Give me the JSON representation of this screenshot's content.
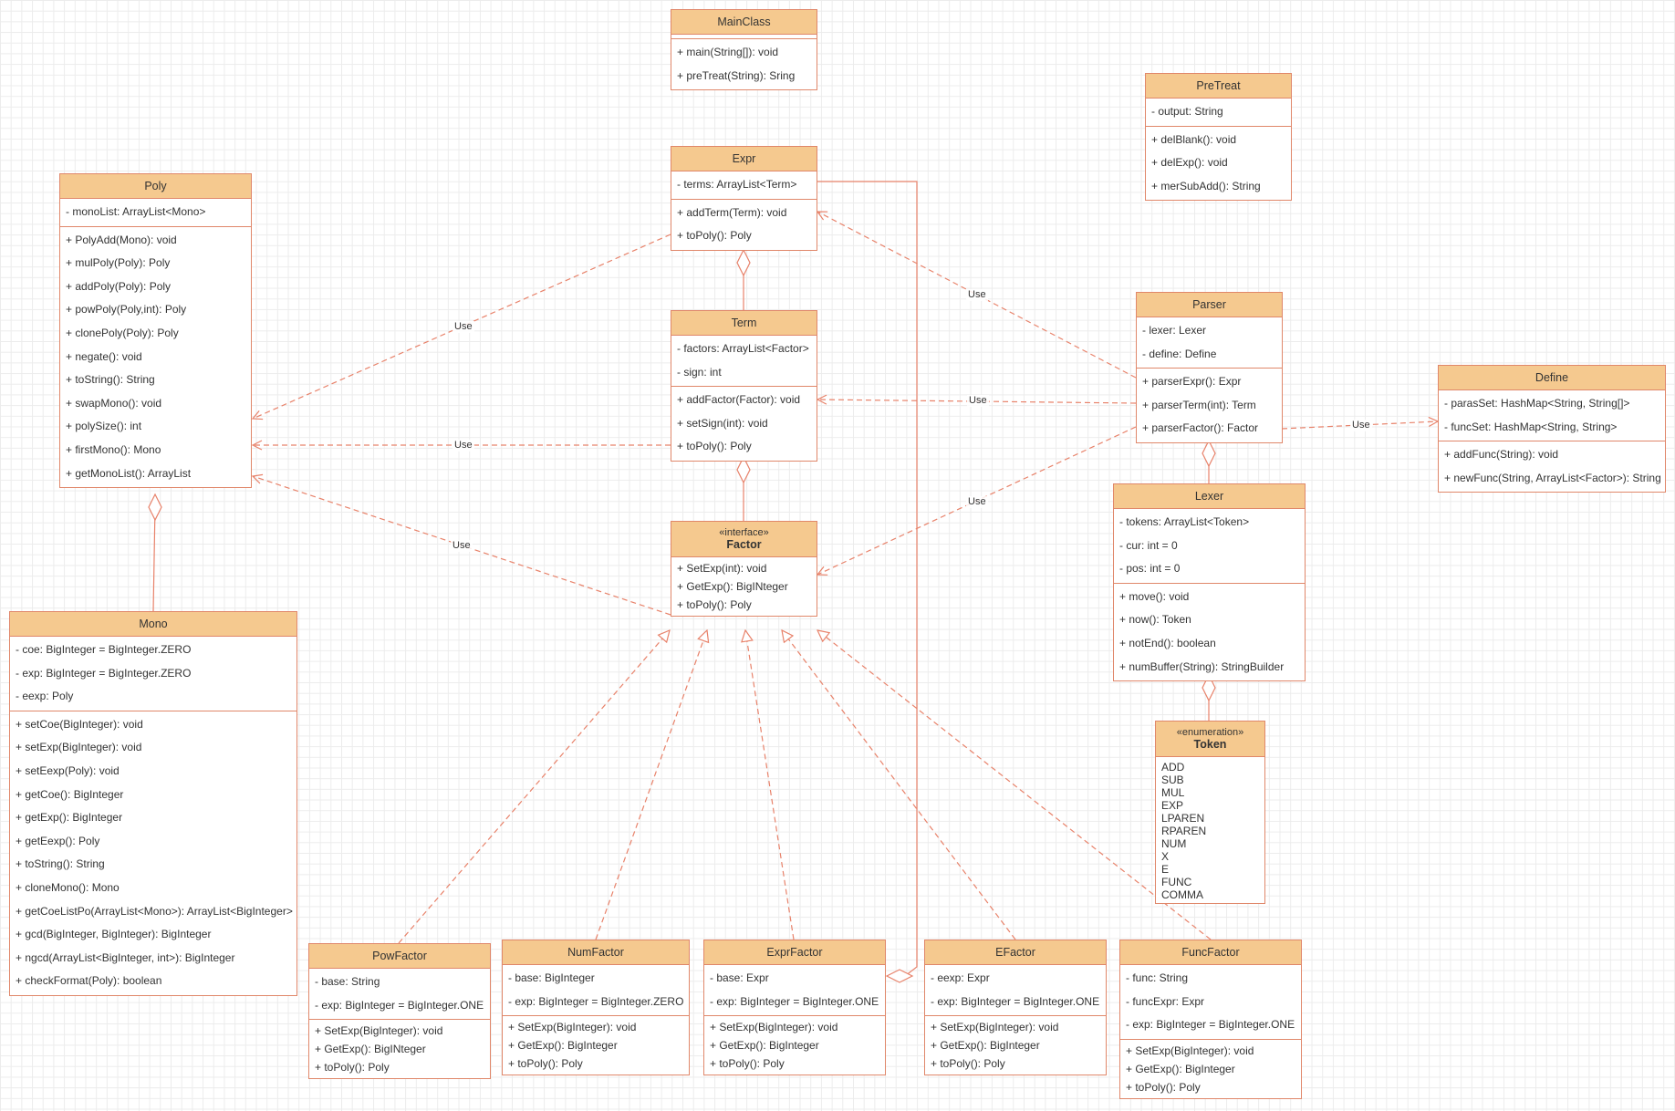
{
  "colors": {
    "header": "#f5c98f",
    "border": "#e0876a",
    "edge": "#e8826a",
    "text": "#333333"
  },
  "classes": {
    "mainclass": {
      "name": "MainClass",
      "attributes": [],
      "methods": [
        "+ main(String[]): void",
        "+ preTreat(String): Sring"
      ]
    },
    "pretreat": {
      "name": "PreTreat",
      "attributes": [
        "- output: String"
      ],
      "methods": [
        "+ delBlank(): void",
        "+ delExp(): void",
        "+ merSubAdd(): String"
      ]
    },
    "expr": {
      "name": "Expr",
      "attributes": [
        "- terms: ArrayList<Term>"
      ],
      "methods": [
        "+ addTerm(Term): void",
        "+ toPoly(): Poly"
      ]
    },
    "poly": {
      "name": "Poly",
      "attributes": [
        "- monoList: ArrayList<Mono>"
      ],
      "methods": [
        "+ PolyAdd(Mono): void",
        "+ mulPoly(Poly): Poly",
        "+ addPoly(Poly): Poly",
        "+ powPoly(Poly,int): Poly",
        "+ clonePoly(Poly): Poly",
        "+ negate(): void",
        "+ toString(): String",
        "+ swapMono(): void",
        "+ polySize(): int",
        "+ firstMono(): Mono",
        "+ getMonoList(): ArrayList"
      ]
    },
    "term": {
      "name": "Term",
      "attributes": [
        "- factors: ArrayList<Factor>",
        "- sign: int"
      ],
      "methods": [
        "+ addFactor(Factor): void",
        "+ setSign(int): void",
        "+ toPoly(): Poly"
      ]
    },
    "parser": {
      "name": "Parser",
      "attributes": [
        "- lexer: Lexer",
        "- define: Define"
      ],
      "methods": [
        "+ parserExpr(): Expr",
        "+ parserTerm(int): Term",
        "+ parserFactor(): Factor"
      ]
    },
    "define": {
      "name": "Define",
      "attributes": [
        "- parasSet: HashMap<String, String[]>",
        "- funcSet: HashMap<String, String>"
      ],
      "methods": [
        "+ addFunc(String): void",
        "+ newFunc(String, ArrayList<Factor>): String"
      ]
    },
    "lexer": {
      "name": "Lexer",
      "attributes": [
        "- tokens: ArrayList<Token>",
        "- cur: int = 0",
        "- pos: int = 0"
      ],
      "methods": [
        "+ move(): void",
        "+ now(): Token",
        "+ notEnd(): boolean",
        "+ numBuffer(String): StringBuilder"
      ]
    },
    "factor": {
      "stereotype": "«interface»",
      "name": "Factor",
      "methods": [
        "+ SetExp(int): void",
        "+ GetExp(): BigINteger",
        "+ toPoly(): Poly"
      ]
    },
    "mono": {
      "name": "Mono",
      "attributes": [
        "- coe: BigInteger = BigInteger.ZERO",
        "- exp: BigInteger = BigInteger.ZERO",
        "- eexp: Poly"
      ],
      "methods": [
        "+ setCoe(BigInteger): void",
        "+ setExp(BigInteger): void",
        "+ setEexp(Poly): void",
        "+ getCoe(): BigInteger",
        "+ getExp(): BigInteger",
        "+ getEexp(): Poly",
        "+ toString(): String",
        "+ cloneMono(): Mono",
        "+ getCoeListPo(ArrayList<Mono>): ArrayList<BigInteger>",
        "+ gcd(BigInteger, BigInteger): BigInteger",
        "+ ngcd(ArrayList<BigInteger, int>): BigInteger",
        "+ checkFormat(Poly): boolean"
      ]
    },
    "token": {
      "stereotype": "«enumeration»",
      "name": "Token",
      "values": [
        "ADD",
        "SUB",
        "MUL",
        "EXP",
        "LPAREN",
        "RPAREN",
        "NUM",
        "X",
        "E",
        "FUNC",
        "COMMA"
      ]
    },
    "powfactor": {
      "name": "PowFactor",
      "attributes": [
        "- base: String",
        "- exp: BigInteger = BigInteger.ONE"
      ],
      "methods": [
        "+ SetExp(BigInteger): void",
        "+ GetExp(): BigINteger",
        "+ toPoly(): Poly"
      ]
    },
    "numfactor": {
      "name": "NumFactor",
      "attributes": [
        "- base: BigInteger",
        "- exp: BigInteger = BigInteger.ZERO"
      ],
      "methods": [
        "+ SetExp(BigInteger): void",
        "+ GetExp(): BigInteger",
        "+ toPoly(): Poly"
      ]
    },
    "exprfactor": {
      "name": "ExprFactor",
      "attributes": [
        "- base: Expr",
        "- exp: BigInteger = BigInteger.ONE"
      ],
      "methods": [
        "+ SetExp(BigInteger): void",
        "+ GetExp(): BigInteger",
        "+ toPoly(): Poly"
      ]
    },
    "efactor": {
      "name": "EFactor",
      "attributes": [
        "- eexp: Expr",
        "- exp: BigInteger = BigInteger.ONE"
      ],
      "methods": [
        "+ SetExp(BigInteger): void",
        "+ GetExp(): BigInteger",
        "+ toPoly(): Poly"
      ]
    },
    "funcfactor": {
      "name": "FuncFactor",
      "attributes": [
        "- func: String",
        "- funcExpr: Expr",
        "- exp: BigInteger = BigInteger.ONE"
      ],
      "methods": [
        "+ SetExp(BigInteger): void",
        "+ GetExp(): BigInteger",
        "+ toPoly(): Poly"
      ]
    }
  },
  "edges": {
    "expr_poly": {
      "label": "Use"
    },
    "term_poly": {
      "label": "Use"
    },
    "factor_poly": {
      "label": "Use"
    },
    "parser_expr": {
      "label": "Use"
    },
    "parser_term": {
      "label": "Use"
    },
    "parser_factor": {
      "label": "Use"
    },
    "parser_define": {
      "label": "Use"
    }
  }
}
